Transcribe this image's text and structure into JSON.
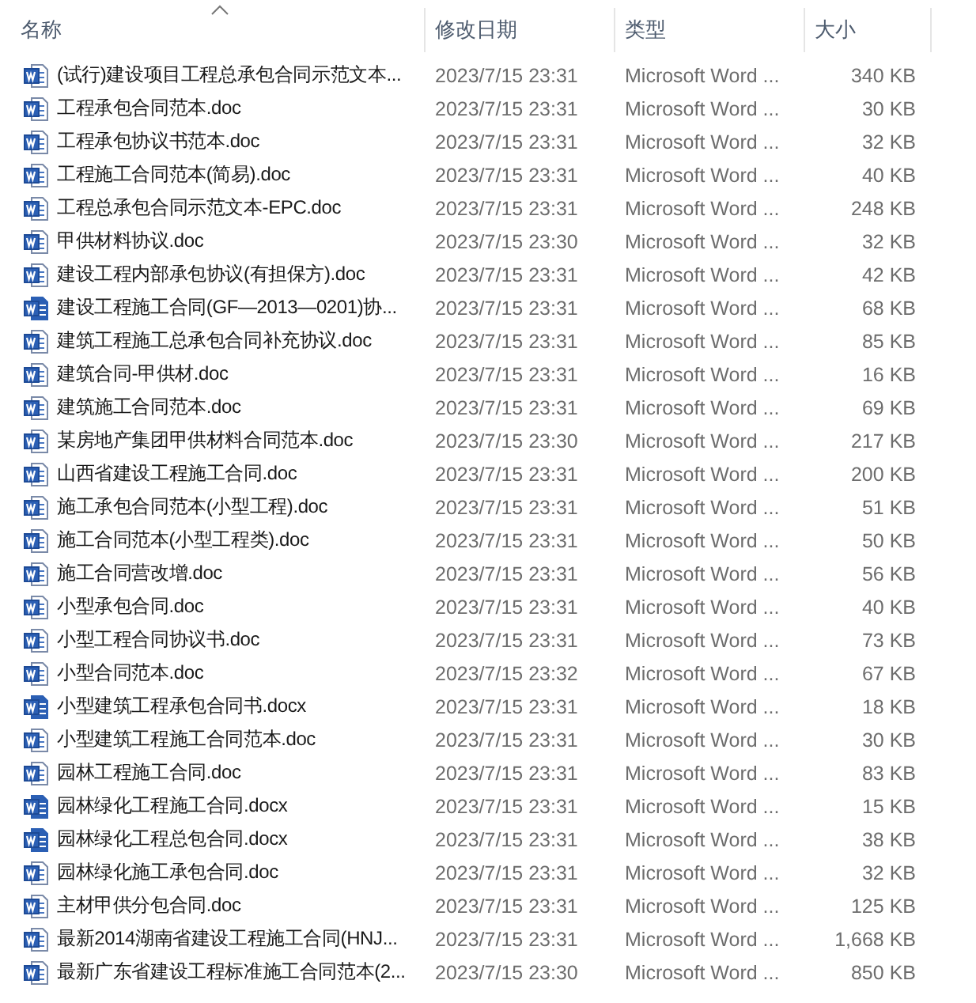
{
  "columns": [
    {
      "label": "名称",
      "sorted": true
    },
    {
      "label": "修改日期",
      "sorted": false
    },
    {
      "label": "类型",
      "sorted": false
    },
    {
      "label": "大小",
      "sorted": false
    }
  ],
  "rows": [
    {
      "name": "(试行)建设项目工程总承包合同示范文本...",
      "date": "2023/7/15 23:31",
      "type": "Microsoft Word ...",
      "size": "340 KB",
      "kind": "doc"
    },
    {
      "name": "工程承包合同范本.doc",
      "date": "2023/7/15 23:31",
      "type": "Microsoft Word ...",
      "size": "30 KB",
      "kind": "doc"
    },
    {
      "name": "工程承包协议书范本.doc",
      "date": "2023/7/15 23:31",
      "type": "Microsoft Word ...",
      "size": "32 KB",
      "kind": "doc"
    },
    {
      "name": "工程施工合同范本(简易).doc",
      "date": "2023/7/15 23:31",
      "type": "Microsoft Word ...",
      "size": "40 KB",
      "kind": "doc"
    },
    {
      "name": "工程总承包合同示范文本-EPC.doc",
      "date": "2023/7/15 23:31",
      "type": "Microsoft Word ...",
      "size": "248 KB",
      "kind": "doc"
    },
    {
      "name": "甲供材料协议.doc",
      "date": "2023/7/15 23:30",
      "type": "Microsoft Word ...",
      "size": "32 KB",
      "kind": "doc"
    },
    {
      "name": "建设工程内部承包协议(有担保方).doc",
      "date": "2023/7/15 23:31",
      "type": "Microsoft Word ...",
      "size": "42 KB",
      "kind": "doc"
    },
    {
      "name": "建设工程施工合同(GF—2013—0201)协...",
      "date": "2023/7/15 23:31",
      "type": "Microsoft Word ...",
      "size": "68 KB",
      "kind": "docx"
    },
    {
      "name": "建筑工程施工总承包合同补充协议.doc",
      "date": "2023/7/15 23:31",
      "type": "Microsoft Word ...",
      "size": "85 KB",
      "kind": "doc"
    },
    {
      "name": "建筑合同-甲供材.doc",
      "date": "2023/7/15 23:31",
      "type": "Microsoft Word ...",
      "size": "16 KB",
      "kind": "doc"
    },
    {
      "name": "建筑施工合同范本.doc",
      "date": "2023/7/15 23:31",
      "type": "Microsoft Word ...",
      "size": "69 KB",
      "kind": "doc"
    },
    {
      "name": "某房地产集团甲供材料合同范本.doc",
      "date": "2023/7/15 23:30",
      "type": "Microsoft Word ...",
      "size": "217 KB",
      "kind": "doc"
    },
    {
      "name": "山西省建设工程施工合同.doc",
      "date": "2023/7/15 23:31",
      "type": "Microsoft Word ...",
      "size": "200 KB",
      "kind": "doc"
    },
    {
      "name": "施工承包合同范本(小型工程).doc",
      "date": "2023/7/15 23:31",
      "type": "Microsoft Word ...",
      "size": "51 KB",
      "kind": "doc"
    },
    {
      "name": "施工合同范本(小型工程类).doc",
      "date": "2023/7/15 23:31",
      "type": "Microsoft Word ...",
      "size": "50 KB",
      "kind": "doc"
    },
    {
      "name": "施工合同营改增.doc",
      "date": "2023/7/15 23:31",
      "type": "Microsoft Word ...",
      "size": "56 KB",
      "kind": "doc"
    },
    {
      "name": "小型承包合同.doc",
      "date": "2023/7/15 23:31",
      "type": "Microsoft Word ...",
      "size": "40 KB",
      "kind": "doc"
    },
    {
      "name": "小型工程合同协议书.doc",
      "date": "2023/7/15 23:31",
      "type": "Microsoft Word ...",
      "size": "73 KB",
      "kind": "doc"
    },
    {
      "name": "小型合同范本.doc",
      "date": "2023/7/15 23:32",
      "type": "Microsoft Word ...",
      "size": "67 KB",
      "kind": "doc"
    },
    {
      "name": "小型建筑工程承包合同书.docx",
      "date": "2023/7/15 23:31",
      "type": "Microsoft Word ...",
      "size": "18 KB",
      "kind": "docx"
    },
    {
      "name": "小型建筑工程施工合同范本.doc",
      "date": "2023/7/15 23:31",
      "type": "Microsoft Word ...",
      "size": "30 KB",
      "kind": "doc"
    },
    {
      "name": "园林工程施工合同.doc",
      "date": "2023/7/15 23:31",
      "type": "Microsoft Word ...",
      "size": "83 KB",
      "kind": "doc"
    },
    {
      "name": "园林绿化工程施工合同.docx",
      "date": "2023/7/15 23:31",
      "type": "Microsoft Word ...",
      "size": "15 KB",
      "kind": "docx"
    },
    {
      "name": "园林绿化工程总包合同.docx",
      "date": "2023/7/15 23:31",
      "type": "Microsoft Word ...",
      "size": "38 KB",
      "kind": "docx"
    },
    {
      "name": "园林绿化施工承包合同.doc",
      "date": "2023/7/15 23:31",
      "type": "Microsoft Word ...",
      "size": "32 KB",
      "kind": "doc"
    },
    {
      "name": "主材甲供分包合同.doc",
      "date": "2023/7/15 23:31",
      "type": "Microsoft Word ...",
      "size": "125 KB",
      "kind": "doc"
    },
    {
      "name": "最新2014湖南省建设工程施工合同(HNJ...",
      "date": "2023/7/15 23:31",
      "type": "Microsoft Word ...",
      "size": "1,668 KB",
      "kind": "doc"
    },
    {
      "name": "最新广东省建设工程标准施工合同范本(2...",
      "date": "2023/7/15 23:30",
      "type": "Microsoft Word ...",
      "size": "850 KB",
      "kind": "doc"
    }
  ]
}
